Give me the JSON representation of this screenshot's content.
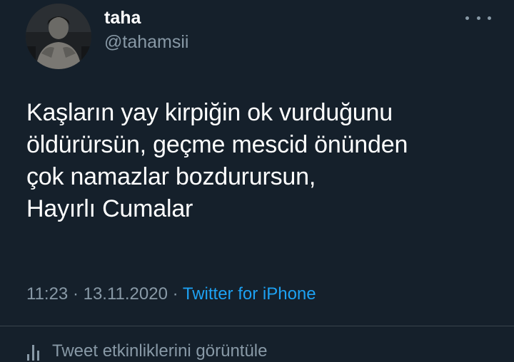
{
  "user": {
    "display_name": "taha",
    "username": "@tahamsii"
  },
  "header": {
    "more_icon": "more-horizontal-icon"
  },
  "tweet": {
    "lines": [
      "Kaşların yay kirpiğin ok vurduğunu",
      "öldürürsün, geçme mescid önünden",
      "çok namazlar bozdurursun,",
      "Hayırlı Cumalar"
    ],
    "time": "11:23",
    "separator1": " · ",
    "date": "13.11.2020",
    "separator2": " · ",
    "source": "Twitter for iPhone"
  },
  "activity": {
    "icon": "analytics-bars-icon",
    "label": "Tweet etkinliklerini görüntüle"
  },
  "colors": {
    "background": "#15202b",
    "primary_text": "#ffffff",
    "secondary_text": "#8899a6",
    "link": "#1da1f2",
    "divider": "#38444d"
  }
}
